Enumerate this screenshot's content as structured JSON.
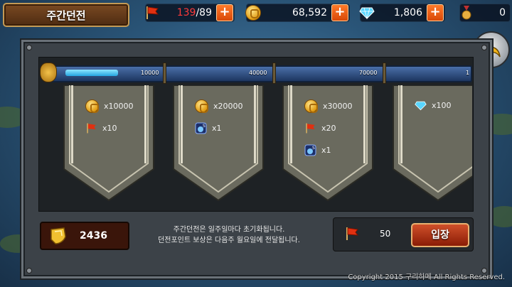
{
  "header": {
    "title": "주간던전",
    "stamina": {
      "current": "139",
      "max": "/89",
      "icon": "flag-icon"
    },
    "gold": {
      "value": "68,592",
      "icon": "coin-icon"
    },
    "gems": {
      "value": "1,806",
      "icon": "diamond-icon"
    },
    "medals": {
      "value": "0",
      "icon": "medal-icon"
    }
  },
  "progress": {
    "fraction": 0.13,
    "milestones": [
      "10000",
      "40000",
      "70000",
      "1"
    ]
  },
  "rewards": [
    {
      "items": [
        {
          "icon": "coin-icon",
          "label": "x10000"
        },
        {
          "icon": "flag-icon",
          "label": "x10"
        }
      ]
    },
    {
      "items": [
        {
          "icon": "coin-icon",
          "label": "x20000"
        },
        {
          "icon": "potion-icon",
          "label": "x1"
        }
      ]
    },
    {
      "items": [
        {
          "icon": "coin-icon",
          "label": "x30000"
        },
        {
          "icon": "flag-icon",
          "label": "x20"
        },
        {
          "icon": "potion-icon",
          "label": "x1"
        }
      ]
    },
    {
      "items": [
        {
          "icon": "diamond-icon",
          "label": "x100"
        }
      ]
    }
  ],
  "points": {
    "value": "2436",
    "icon": "shield-icon"
  },
  "notice": {
    "line1": "주간던전은 일주일마다 초기화됩니다.",
    "line2": "던전포인트 보상은 다음주 월요일에 전달됩니다."
  },
  "entry": {
    "cost": "50",
    "button_label": "입장",
    "icon": "flag-icon"
  },
  "copyright": "Copyright 2015 구리하메 All Rights Reserved.",
  "colors": {
    "accent": "#e05010",
    "stamina_red": "#ff3a3a",
    "progress": "#25a4e0"
  }
}
